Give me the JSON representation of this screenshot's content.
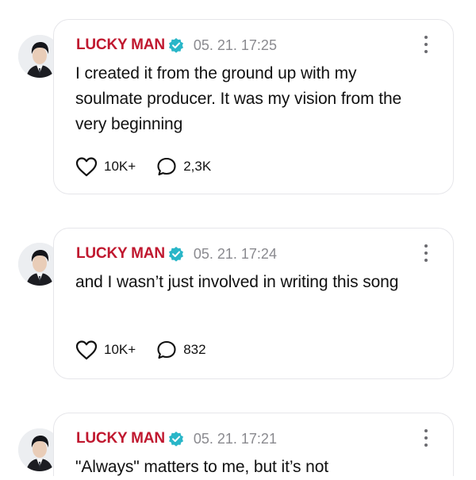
{
  "posts": [
    {
      "author": "LUCKY MAN",
      "time": "05. 21. 17:25",
      "text": "I created it from the ground up with my soulmate producer. It was my vision from the very beginning",
      "likes": "10K+",
      "comments": "2,3K"
    },
    {
      "author": "LUCKY MAN",
      "time": "05. 21. 17:24",
      "text": "and I wasn’t just involved in writing this song",
      "likes": "10K+",
      "comments": "832"
    },
    {
      "author": "LUCKY MAN",
      "time": "05. 21. 17:21",
      "text": "\"Always\" matters to me, but it’s not"
    }
  ],
  "icons": {
    "like": "heart-icon",
    "comment": "comment-bubble-icon",
    "verified": "verified-badge-icon",
    "more": "more-vertical-icon"
  },
  "colors": {
    "author": "#c0182f",
    "verified": "#29b6c8",
    "time": "#8a8a8f",
    "card_border": "#e6e6ea"
  }
}
